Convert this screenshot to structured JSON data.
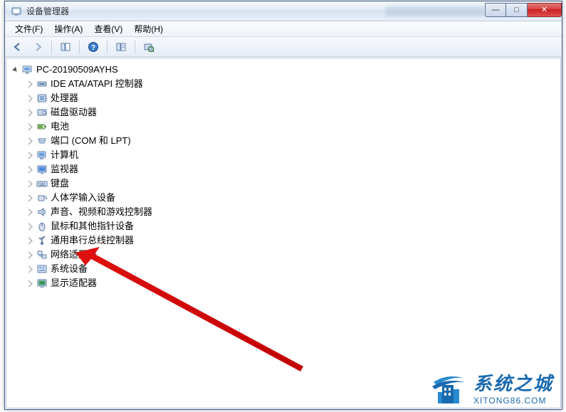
{
  "window": {
    "title": "设备管理器",
    "controls": {
      "min": "—",
      "max": "□",
      "close": "✕"
    }
  },
  "menu": {
    "file": "文件(F)",
    "action": "操作(A)",
    "view": "查看(V)",
    "help": "帮助(H)"
  },
  "toolbar": {
    "back": "后退",
    "forward": "前进",
    "up": "显示/隐藏控制台树",
    "help": "帮助",
    "props": "属性",
    "scan": "扫描检测硬件改动"
  },
  "tree": {
    "root": "PC-20190509AYHS",
    "items": [
      {
        "label": "IDE ATA/ATAPI 控制器",
        "icon": "ide"
      },
      {
        "label": "处理器",
        "icon": "cpu"
      },
      {
        "label": "磁盘驱动器",
        "icon": "disk"
      },
      {
        "label": "电池",
        "icon": "battery"
      },
      {
        "label": "端口 (COM 和 LPT)",
        "icon": "port"
      },
      {
        "label": "计算机",
        "icon": "computer"
      },
      {
        "label": "监视器",
        "icon": "monitor"
      },
      {
        "label": "键盘",
        "icon": "keyboard"
      },
      {
        "label": "人体学输入设备",
        "icon": "hid"
      },
      {
        "label": "声音、视频和游戏控制器",
        "icon": "sound"
      },
      {
        "label": "鼠标和其他指针设备",
        "icon": "mouse"
      },
      {
        "label": "通用串行总线控制器",
        "icon": "usb"
      },
      {
        "label": "网络适配器",
        "icon": "network",
        "highlighted": true
      },
      {
        "label": "系统设备",
        "icon": "system"
      },
      {
        "label": "显示适配器",
        "icon": "display"
      }
    ]
  },
  "watermark": {
    "title": "系统之城",
    "url": "XITONG86.COM"
  }
}
